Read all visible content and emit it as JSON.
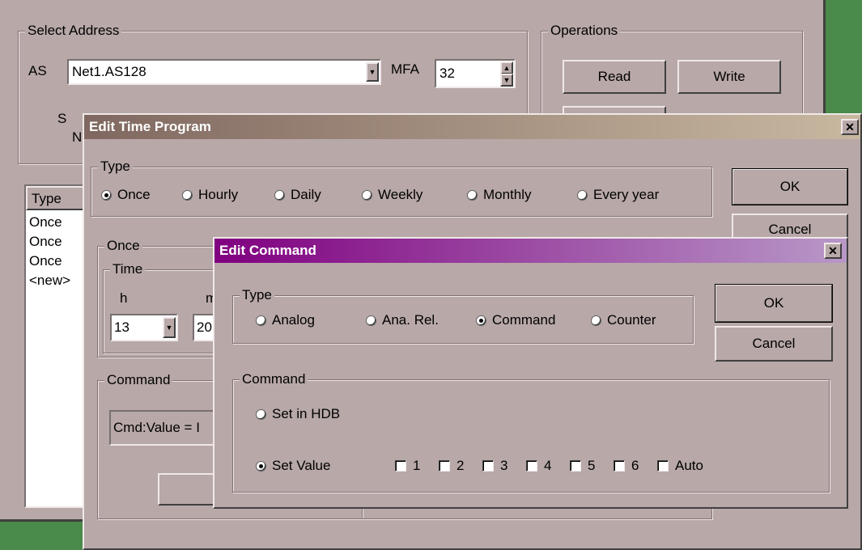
{
  "main": {
    "select_address": {
      "legend": "Select Address",
      "as_label": "AS",
      "as_value": "Net1.AS128",
      "mfa_label": "MFA",
      "mfa_value": "32",
      "sl_label_partial": "S",
      "n_label_partial": "N"
    },
    "operations": {
      "legend": "Operations",
      "read": "Read",
      "write": "Write"
    },
    "list": {
      "header": "Type",
      "rows": [
        "Once",
        "Once",
        "Once",
        "<new>"
      ]
    }
  },
  "time_program": {
    "title": "Edit Time Program",
    "type_legend": "Type",
    "types": [
      "Once",
      "Hourly",
      "Daily",
      "Weekly",
      "Monthly",
      "Every year"
    ],
    "selected_type": "Once",
    "ok": "OK",
    "cancel": "Cancel",
    "once_legend": "Once",
    "time_legend": "Time",
    "h_label": "h",
    "m_label": "m",
    "h_value": "13",
    "m_value": "20",
    "command_legend": "Command",
    "command_value": "Cmd:Value = I"
  },
  "edit_command": {
    "title": "Edit Command",
    "type_legend": "Type",
    "types": [
      "Analog",
      "Ana. Rel.",
      "Command",
      "Counter"
    ],
    "selected_type": "Command",
    "ok": "OK",
    "cancel": "Cancel",
    "command_legend": "Command",
    "set_in_hdb": "Set in HDB",
    "set_value": "Set Value",
    "selected_command": "Set Value",
    "checkboxes": [
      "1",
      "2",
      "3",
      "4",
      "5",
      "6",
      "Auto"
    ]
  },
  "colors": {
    "dialog_bg": "#b8a8a8",
    "time_program_title_from": "#806860",
    "time_program_title_to": "#c8b8a0",
    "edit_command_title_from": "#800080",
    "edit_command_title_to": "#b898c8",
    "desktop_green": "#4a8a4a"
  }
}
